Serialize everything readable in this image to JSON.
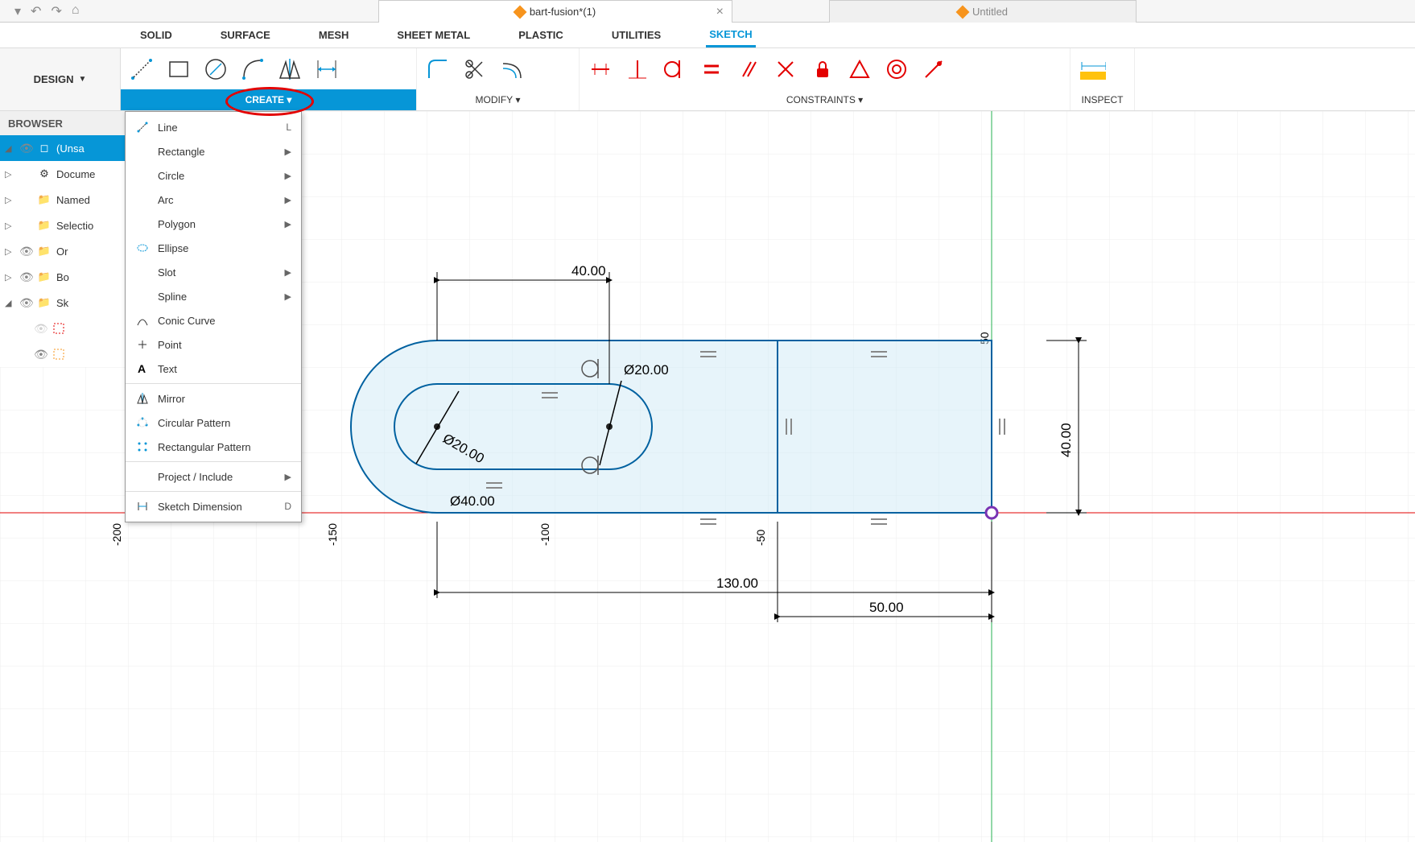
{
  "file_tabs": {
    "active_name": "bart-fusion*(1)",
    "secondary_name": "Untitled"
  },
  "env_tabs": [
    "SOLID",
    "SURFACE",
    "MESH",
    "SHEET METAL",
    "PLASTIC",
    "UTILITIES",
    "SKETCH"
  ],
  "design_label": "DESIGN",
  "groups": {
    "create": "CREATE",
    "modify": "MODIFY",
    "constraints": "CONSTRAINTS",
    "inspect": "INSPECT"
  },
  "browser": {
    "title": "BROWSER",
    "root": "(Unsa",
    "items": [
      "Docume",
      "Named",
      "Selectio",
      "Or",
      "Bo",
      "Sk"
    ]
  },
  "create_menu": [
    {
      "icon": "line",
      "label": "Line",
      "shortcut": "L"
    },
    {
      "icon": "rect",
      "label": "Rectangle",
      "sub": true
    },
    {
      "icon": "circle",
      "label": "Circle",
      "sub": true
    },
    {
      "icon": "arc",
      "label": "Arc",
      "sub": true
    },
    {
      "icon": "poly",
      "label": "Polygon",
      "sub": true
    },
    {
      "icon": "ellipse",
      "label": "Ellipse"
    },
    {
      "icon": "slot",
      "label": "Slot",
      "sub": true
    },
    {
      "icon": "spline",
      "label": "Spline",
      "sub": true
    },
    {
      "icon": "conic",
      "label": "Conic Curve"
    },
    {
      "icon": "point",
      "label": "Point"
    },
    {
      "icon": "text",
      "label": "Text"
    },
    {
      "sep": true
    },
    {
      "icon": "mirror",
      "label": "Mirror"
    },
    {
      "icon": "cpat",
      "label": "Circular Pattern"
    },
    {
      "icon": "rpat",
      "label": "Rectangular Pattern"
    },
    {
      "sep": true
    },
    {
      "label": "Project / Include",
      "sub": true,
      "noicon": true
    },
    {
      "sep": true
    },
    {
      "icon": "dim",
      "label": "Sketch Dimension",
      "shortcut": "D"
    }
  ],
  "dims": {
    "d40_top": "40.00",
    "d20a": "Ø20.00",
    "d20b": "Ø20.00",
    "d40dia": "Ø40.00",
    "d40_right": "40.00",
    "d130": "130.00",
    "d50": "50.00"
  },
  "axis_x": [
    "-200",
    "-150",
    "-100",
    "-50"
  ],
  "axis_y": "50"
}
